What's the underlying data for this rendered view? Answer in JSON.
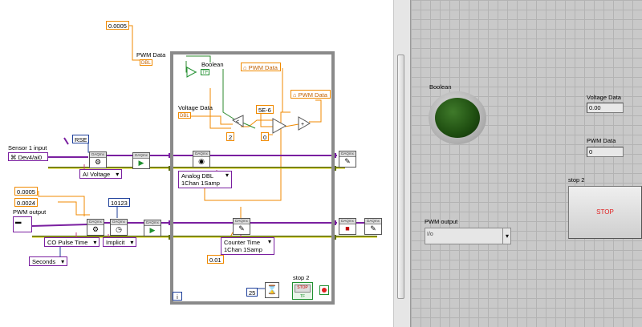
{
  "block_diagram": {
    "const_top": "0.0005",
    "pwm_data_top_label": "PWM Data",
    "dbl": "DBL",
    "bool_label": "Boolean",
    "tf": "TF",
    "pwm_data_local1": "PWM Data",
    "pwm_data_local2": "PWM Data",
    "voltage_data_label": "Voltage Data",
    "const_5e6": "5E-6",
    "const_2": "2",
    "const_0": "0",
    "rse": "RSE",
    "sensor_label": "Sensor 1 input",
    "sensor_value": "Dev4/ai0",
    "ai_voltage": "AI Voltage",
    "analog_dbl_line1": "Analog DBL",
    "analog_dbl_line2": "1Chan 1Samp",
    "const_00005b": "0.0005",
    "const_00024": "0.0024",
    "pwm_output_label": "PWM output",
    "const_10123": "10123",
    "co_pulse_time": "CO Pulse Time",
    "implicit": "Implicit",
    "seconds": "Seconds",
    "counter_time_line1": "Counter Time",
    "counter_time_line2": "1Chan 1Samp",
    "const_001": "0.01",
    "stop2_label": "stop 2",
    "stop_text": "STOP",
    "tf2": "TF",
    "const_25": "25",
    "iter": "i",
    "daqmx": "DAQmx"
  },
  "front_panel": {
    "boolean_label": "Boolean",
    "voltage_data_label": "Voltage Data",
    "voltage_data_value": "0.00",
    "pwm_data_label": "PWM Data",
    "pwm_data_value": "0",
    "stop2_label": "stop 2",
    "stop_button_text": "STOP",
    "pwm_output_label": "PWM output",
    "pwm_output_icon": "I/o"
  },
  "colors": {
    "led_green": "#1e4d10",
    "stop_text": "#e02020",
    "wire_orange": "#f08a00",
    "wire_purple": "#7a1fa0",
    "wire_green": "#2d8a2d"
  }
}
